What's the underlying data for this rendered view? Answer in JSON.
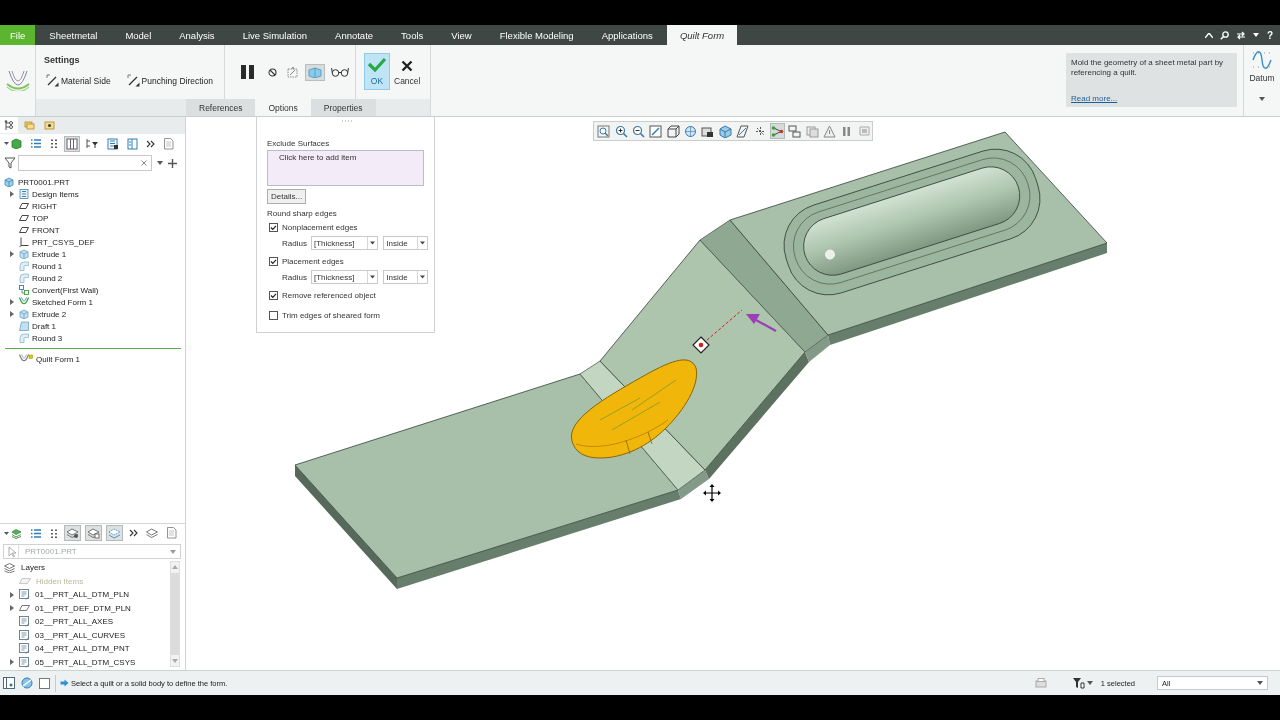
{
  "ribbon_tabs": [
    {
      "label": "File",
      "kind": "file",
      "selected": false
    },
    {
      "label": "Sheetmetal",
      "kind": "tab",
      "selected": false
    },
    {
      "label": "Model",
      "kind": "tab",
      "selected": false
    },
    {
      "label": "Analysis",
      "kind": "tab",
      "selected": false
    },
    {
      "label": "Live Simulation",
      "kind": "tab",
      "selected": false
    },
    {
      "label": "Annotate",
      "kind": "tab",
      "selected": false
    },
    {
      "label": "Tools",
      "kind": "tab",
      "selected": false
    },
    {
      "label": "View",
      "kind": "tab",
      "selected": false
    },
    {
      "label": "Flexible Modeling",
      "kind": "tab",
      "selected": false
    },
    {
      "label": "Applications",
      "kind": "tab",
      "selected": false
    },
    {
      "label": "Quilt Form",
      "kind": "tab",
      "selected": true
    }
  ],
  "help": "?",
  "ribbon": {
    "settings": {
      "title": "Settings",
      "buttons": [
        "Material Side",
        "Punching Direction"
      ]
    },
    "toggles": [
      {
        "kind": "pause",
        "on": false
      },
      {
        "kind": "stop",
        "on": false
      },
      {
        "kind": "preview",
        "on": false
      },
      {
        "kind": "verify",
        "on": true
      },
      {
        "kind": "glasses",
        "on": false
      }
    ],
    "actions": [
      {
        "kind": "ok",
        "label": "OK",
        "highlighted": true
      },
      {
        "kind": "cancel",
        "label": "Cancel",
        "highlighted": false
      }
    ],
    "panel_tabs": [
      {
        "label": "References",
        "selected": false
      },
      {
        "label": "Options",
        "selected": true
      },
      {
        "label": "Properties",
        "selected": false
      }
    ],
    "info": {
      "text": "Mold the geometry of a sheet metal part by referencing a quilt.",
      "link": "Read more..."
    },
    "datum": {
      "label": "Datum"
    }
  },
  "options_panel": {
    "exclude_label": "Exclude Surfaces",
    "collector_prompt": "Click here to add item",
    "details_button": "Details...",
    "round_label": "Round sharp edges",
    "rows": [
      {
        "kind": "checkbox",
        "label": "Nonplacement edges",
        "checked": true
      },
      {
        "kind": "radius",
        "label": "Radius",
        "value": "[Thickness]",
        "side": "Inside"
      },
      {
        "kind": "checkbox",
        "label": "Placement edges",
        "checked": true
      },
      {
        "kind": "radius",
        "label": "Radius",
        "value": "[Thickness]",
        "side": "Inside"
      },
      {
        "kind": "checkbox",
        "label": "Remove referenced object",
        "checked": true
      },
      {
        "kind": "checkbox",
        "label": "Trim edges of sheared form",
        "checked": false
      }
    ]
  },
  "model_tree": {
    "panel_tabs": [
      {
        "selected": true
      },
      {
        "selected": false
      },
      {
        "selected": false
      }
    ],
    "toolbar": [
      {
        "on": false
      },
      {
        "on": false
      },
      {
        "on": false
      },
      {
        "on": true
      },
      {
        "on": false
      },
      {
        "on": false
      },
      {
        "on": false
      },
      {
        "on": false
      },
      {
        "on": false
      }
    ],
    "items": [
      {
        "label": "PRT0001.PRT",
        "kind": "part",
        "collapsed": false,
        "children": [
          {
            "label": "Design Items",
            "kind": "design-items",
            "collapsed": true
          },
          {
            "label": "RIGHT",
            "kind": "plane",
            "collapsed": false
          },
          {
            "label": "TOP",
            "kind": "plane",
            "collapsed": false
          },
          {
            "label": "FRONT",
            "kind": "plane",
            "collapsed": false
          },
          {
            "label": "PRT_CSYS_DEF",
            "kind": "csys",
            "collapsed": false
          },
          {
            "label": "Extrude 1",
            "kind": "extrude",
            "collapsed": true
          },
          {
            "label": "Round 1",
            "kind": "round",
            "collapsed": false
          },
          {
            "label": "Round 2",
            "kind": "round",
            "collapsed": false
          },
          {
            "label": "Convert(First Wall)",
            "kind": "convert",
            "collapsed": false
          },
          {
            "label": "Sketched Form 1",
            "kind": "sketched-form",
            "collapsed": true
          },
          {
            "label": "Extrude 2",
            "kind": "extrude",
            "collapsed": true
          },
          {
            "label": "Draft 1",
            "kind": "draft",
            "collapsed": false
          },
          {
            "label": "Round 3",
            "kind": "round",
            "collapsed": false
          },
          {
            "kind": "insert-marker"
          },
          {
            "label": "Quilt Form 1",
            "kind": "quilt-form",
            "collapsed": false
          }
        ]
      }
    ]
  },
  "layer_tree": {
    "toolbar": [
      {
        "on": false
      },
      {
        "on": false
      },
      {
        "on": false
      },
      {
        "on": true
      },
      {
        "on": true
      },
      {
        "on": true
      },
      {
        "on": false
      },
      {
        "on": false
      },
      {
        "on": false
      }
    ],
    "selector": {
      "value": "PRT0001.PRT",
      "disabled": true
    },
    "items": [
      {
        "label": "Layers",
        "kind": "layers",
        "collapsed": false,
        "disabled": false,
        "children": [
          {
            "label": "Hidden Items",
            "kind": "hidden",
            "collapsed": false,
            "disabled": true
          },
          {
            "label": "01__PRT_ALL_DTM_PLN",
            "kind": "layer",
            "collapsed": true,
            "disabled": false
          },
          {
            "label": "01__PRT_DEF_DTM_PLN",
            "kind": "plane-layer",
            "collapsed": true,
            "disabled": false
          },
          {
            "label": "02__PRT_ALL_AXES",
            "kind": "layer",
            "collapsed": false,
            "disabled": false
          },
          {
            "label": "03__PRT_ALL_CURVES",
            "kind": "layer",
            "collapsed": false,
            "disabled": false
          },
          {
            "label": "04__PRT_ALL_DTM_PNT",
            "kind": "layer",
            "collapsed": false,
            "disabled": false
          },
          {
            "label": "05__PRT_ALL_DTM_CSYS",
            "kind": "layer",
            "collapsed": true,
            "disabled": false
          }
        ]
      }
    ]
  },
  "graphics": {
    "view_toolbar": [
      {
        "on": false
      },
      {
        "on": false
      },
      {
        "on": false
      },
      {
        "on": false
      },
      {
        "on": false
      },
      {
        "on": false
      },
      {
        "on": false
      },
      {
        "on": false
      },
      {
        "on": false
      },
      {
        "on": false
      },
      {
        "on": true
      },
      {
        "on": false
      },
      {
        "on": false
      },
      {
        "on": false
      },
      {
        "on": false
      },
      {
        "on": false
      }
    ]
  },
  "status_bar": {
    "message": "Select a quilt or a solid body to define the form.",
    "selection": "1 selected",
    "filter": "All"
  }
}
